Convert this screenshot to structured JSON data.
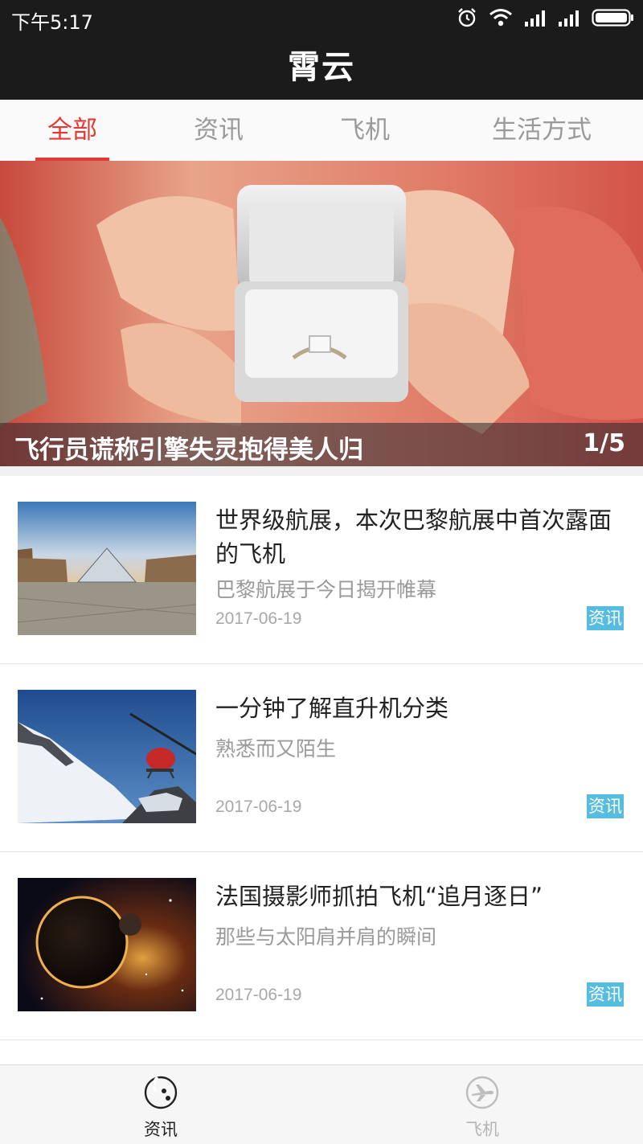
{
  "status_bar": {
    "time": "下午5:17",
    "icons": [
      "alarm-icon",
      "wifi-icon",
      "signal-icon",
      "signal-icon",
      "battery-icon"
    ]
  },
  "header": {
    "title": "霄云"
  },
  "tabs": [
    {
      "label": "全部",
      "active": true
    },
    {
      "label": "资讯",
      "active": false
    },
    {
      "label": "飞机",
      "active": false
    },
    {
      "label": "生活方式",
      "active": false
    }
  ],
  "banner": {
    "title": "飞行员谎称引擎失灵抱得美人归",
    "index": "1/5"
  },
  "news": [
    {
      "title": "世界级航展，本次巴黎航展中首次露面的飞机",
      "subtitle": "巴黎航展于今日揭开帷幕",
      "date": "2017-06-19",
      "tag": "资讯"
    },
    {
      "title": "一分钟了解直升机分类",
      "subtitle": "熟悉而又陌生",
      "date": "2017-06-19",
      "tag": "资讯"
    },
    {
      "title": "法国摄影师抓拍飞机“追月逐日”",
      "subtitle": "那些与太阳肩并肩的瞬间",
      "date": "2017-06-19",
      "tag": "资讯"
    }
  ],
  "bottom_nav": [
    {
      "label": "资讯",
      "icon": "news-icon",
      "active": true
    },
    {
      "label": "飞机",
      "icon": "airplane-icon",
      "active": false
    }
  ],
  "colors": {
    "accent": "#e53935",
    "header_bg": "#1b1b1b",
    "tag_bg": "#57bde0"
  }
}
